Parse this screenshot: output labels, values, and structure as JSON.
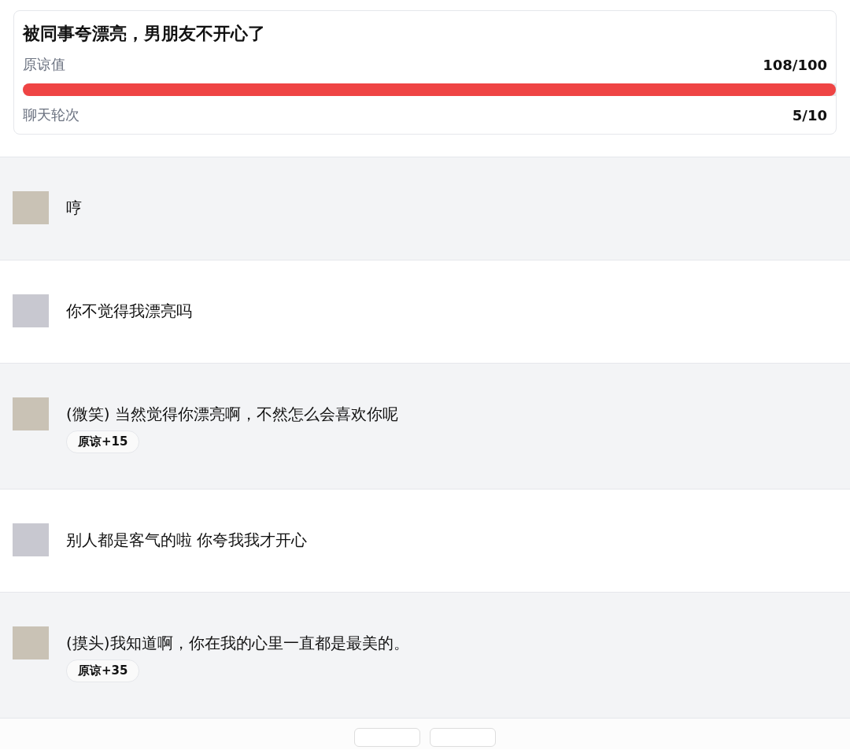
{
  "header": {
    "title": "被同事夸漂亮，男朋友不开心了",
    "forgiveness": {
      "label": "原谅值",
      "reading": "108/100",
      "level": 1
    },
    "rounds": {
      "label": "聊天轮次",
      "reading": "5/10"
    }
  },
  "messages": [
    {
      "kind": "partner",
      "text": "哼"
    },
    {
      "kind": "user",
      "text": "你不觉得我漂亮吗"
    },
    {
      "kind": "partner",
      "text": "(微笑) 当然觉得你漂亮啊，不然怎么会喜欢你呢",
      "badge": "原谅+15"
    },
    {
      "kind": "user",
      "text": "别人都是客气的啦 你夸我我才开心"
    },
    {
      "kind": "partner",
      "text": "(摸头)我知道啊，你在我的心里一直都是最美的。",
      "badge": "原谅+35"
    }
  ]
}
